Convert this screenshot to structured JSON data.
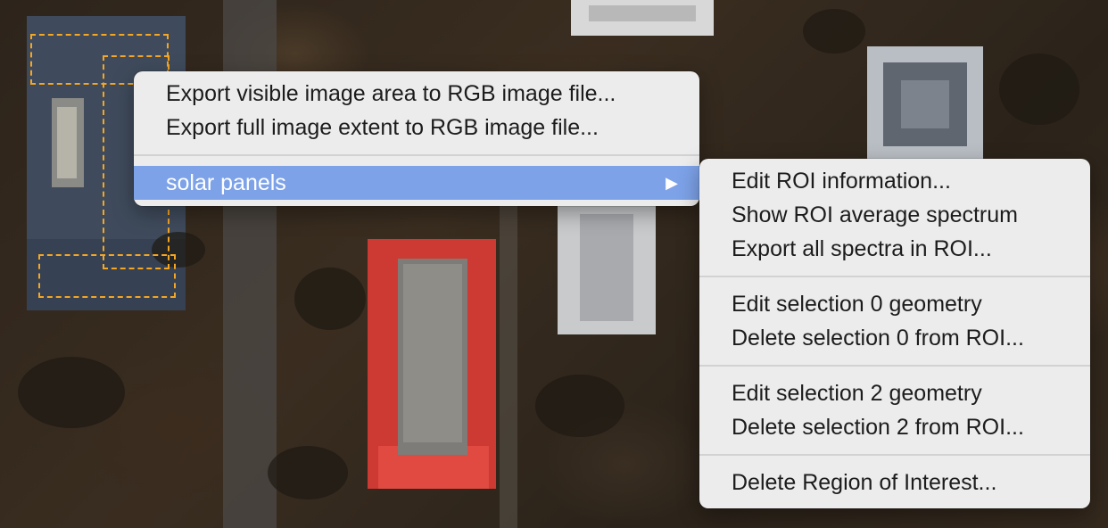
{
  "context_menu": {
    "items": [
      {
        "label": "Export visible image area to RGB image file..."
      },
      {
        "label": "Export full image extent to RGB image file..."
      }
    ],
    "roi_item": {
      "label": "solar panels",
      "submenu_arrow": "▶"
    }
  },
  "submenu": {
    "group1": [
      {
        "label": "Edit ROI information..."
      },
      {
        "label": "Show ROI average spectrum"
      },
      {
        "label": "Export all spectra in ROI..."
      }
    ],
    "group2": [
      {
        "label": "Edit selection 0 geometry"
      },
      {
        "label": "Delete selection 0 from ROI..."
      }
    ],
    "group3": [
      {
        "label": "Edit selection 2 geometry"
      },
      {
        "label": "Delete selection 2 from ROI..."
      }
    ],
    "group4": [
      {
        "label": "Delete Region of Interest..."
      }
    ]
  },
  "colors": {
    "menu_bg": "#ececec",
    "highlight": "#7da2e8",
    "roi_red": "#cc3a33",
    "selection_outline": "#f5a623"
  }
}
